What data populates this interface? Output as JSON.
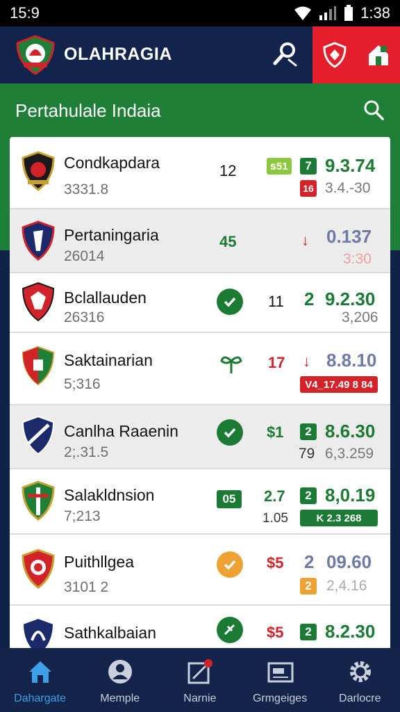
{
  "status_bar": {
    "time": "15:9",
    "clock": "1:38"
  },
  "header": {
    "title": "OLAHRAGIA"
  },
  "section": {
    "title": "Pertahulale Indaia"
  },
  "rows": [
    {
      "name": "Condkapdara",
      "sub": "3331.8",
      "mid": "12",
      "badge": "ꜱ51",
      "flag": "7",
      "odds": "9.3.74",
      "flag2": "16",
      "sub_odds": "3.4.-30"
    },
    {
      "name": "Pertaningaria",
      "sub": "26014",
      "mid": "45",
      "arrow": "↓",
      "odds": "0.137",
      "sub_odds": "3:30"
    },
    {
      "name": "Bclallauden",
      "sub": "26316",
      "mid": "11",
      "lead": "2",
      "odds": "9.2.30",
      "sub_odds": "3,206"
    },
    {
      "name": "Saktainarian",
      "sub": "5;316",
      "mid": "17",
      "arrow": "↓",
      "odds": "8.8.10",
      "pill": "V4_17.49 8 84"
    },
    {
      "name": "Canlha Raaenin",
      "sub": "2;.31.5",
      "mid": "$1",
      "flag": "2",
      "odds": "8.6.30",
      "sub_left": "79",
      "sub_odds": "6,3.259"
    },
    {
      "name": "Salakldnsion",
      "sub": "7;213",
      "badge": "05",
      "mid": "2.7",
      "sub_mid": "1.05",
      "flag": "2",
      "odds": "8,0.19",
      "pill": "K 2.3 268"
    },
    {
      "name": "Puithllgea",
      "sub": "3101 2",
      "mid": "$5",
      "lead": "2",
      "odds": "09.60",
      "flag2": "2",
      "sub_odds": "2,4.16"
    },
    {
      "name": "Sathkalbaian",
      "sub": "",
      "mid": "$5",
      "flag": "2",
      "odds": "8.2.30"
    }
  ],
  "tabs": [
    {
      "label": "Dahargate",
      "icon": "home-icon"
    },
    {
      "label": "Memple",
      "icon": "profile-icon"
    },
    {
      "label": "Narnie",
      "icon": "ticket-icon"
    },
    {
      "label": "Grmgeiges",
      "icon": "card-icon"
    },
    {
      "label": "Darlocre",
      "icon": "gear-icon"
    }
  ],
  "colors": {
    "navy": "#13244c",
    "green": "#1f7f37",
    "red": "#e41e2b",
    "accent_green": "#1b7a33",
    "accent_red": "#d2232a",
    "accent_orange": "#eea234",
    "lime": "#8dc63f",
    "slate": "#6f7aa6",
    "tab_active": "#3ea0e8"
  }
}
